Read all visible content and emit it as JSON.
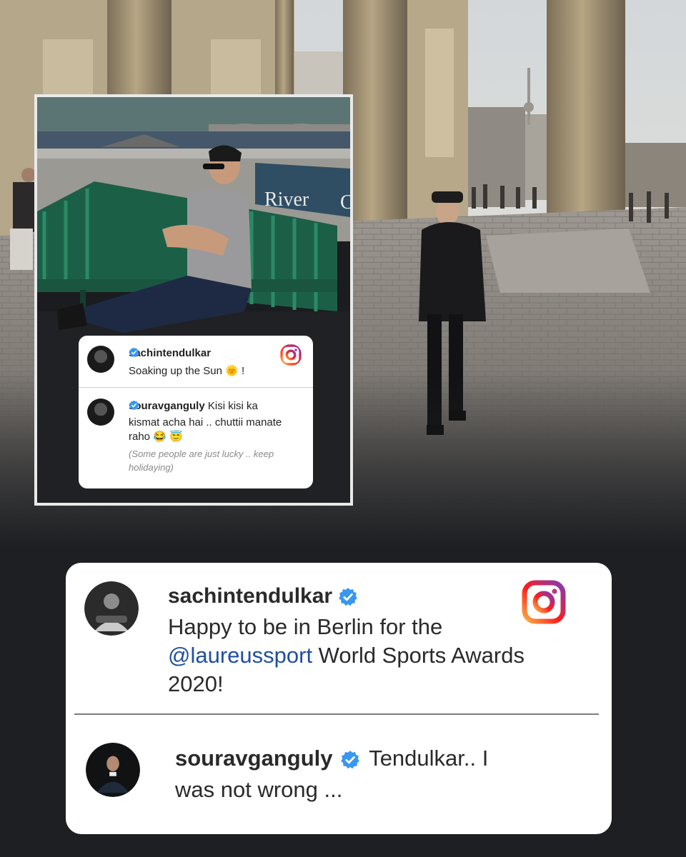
{
  "colors": {
    "card_bg": "#ffffff",
    "page_bg": "#1d1f23",
    "mention": "#1f4fa0",
    "verified": "#3897f0",
    "bench": "#1f6a4e"
  },
  "inset": {
    "sign_text": "River",
    "sign_cut": "C",
    "card": {
      "post": {
        "username": "sachintendulkar",
        "caption": "Soaking up the Sun 🌞 !"
      },
      "reply": {
        "username": "souravganguly",
        "text_line1": "Kisi kisi ka",
        "text_line2": "kismat acha hai .. chuttii manate",
        "text_line3": "raho 😂 😇",
        "translation_line1": "(Some people are just lucky .. keep",
        "translation_line2": "holidaying)"
      },
      "icon": "instagram-icon"
    }
  },
  "main_card": {
    "post": {
      "username": "sachintendulkar",
      "line1": "Happy to be in Berlin for the",
      "mention": "@laureussport",
      "line2_rest": " World Sports Awards",
      "line3": "2020!"
    },
    "reply": {
      "username": "souravganguly",
      "text_inline": "Tendulkar.. I",
      "text_line2": "was not wrong ..."
    },
    "icon": "instagram-icon"
  }
}
